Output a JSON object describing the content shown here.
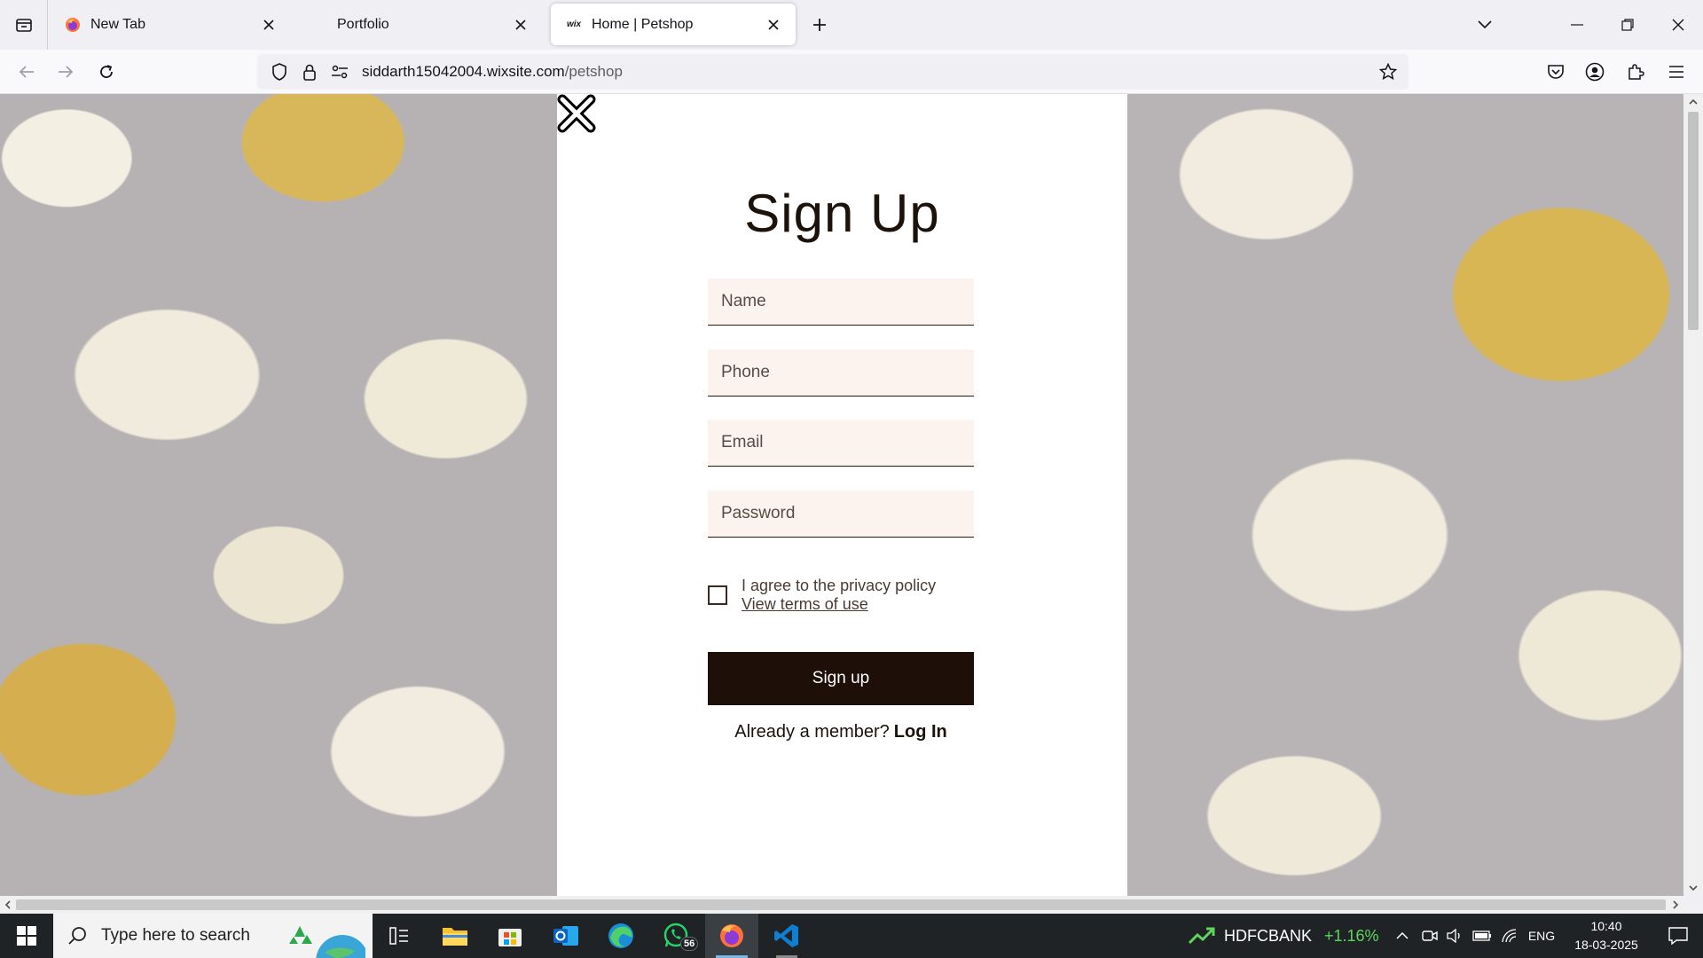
{
  "browser": {
    "tabs": [
      {
        "title": "New Tab",
        "favicon": "firefox-icon"
      },
      {
        "title": "Portfolio",
        "favicon": ""
      },
      {
        "title": "Home | Petshop",
        "favicon": "wix-icon",
        "favicon_text": "wix"
      }
    ],
    "active_tab": 2,
    "url_host": "siddarth15042004.wixsite.com",
    "url_path": "/petshop"
  },
  "signup": {
    "title": "Sign Up",
    "fields": {
      "name_placeholder": "Name",
      "phone_placeholder": "Phone",
      "email_placeholder": "Email",
      "password_placeholder": "Password"
    },
    "agree_label": "I agree to the privacy policy",
    "terms_link": "View terms of use",
    "submit_label": "Sign up",
    "member_prompt": "Already a member?",
    "login_link": "Log In"
  },
  "taskbar": {
    "search_placeholder": "Type here to search",
    "whatsapp_badge": "56",
    "stock_name": "HDFCBANK",
    "stock_change": "+1.16%",
    "language": "ENG",
    "time": "10:40",
    "date": "18-03-2025"
  },
  "colors": {
    "accent_dark": "#1e0f08",
    "field_bg": "#fdf3ee",
    "stock_up": "#5fd45f"
  }
}
